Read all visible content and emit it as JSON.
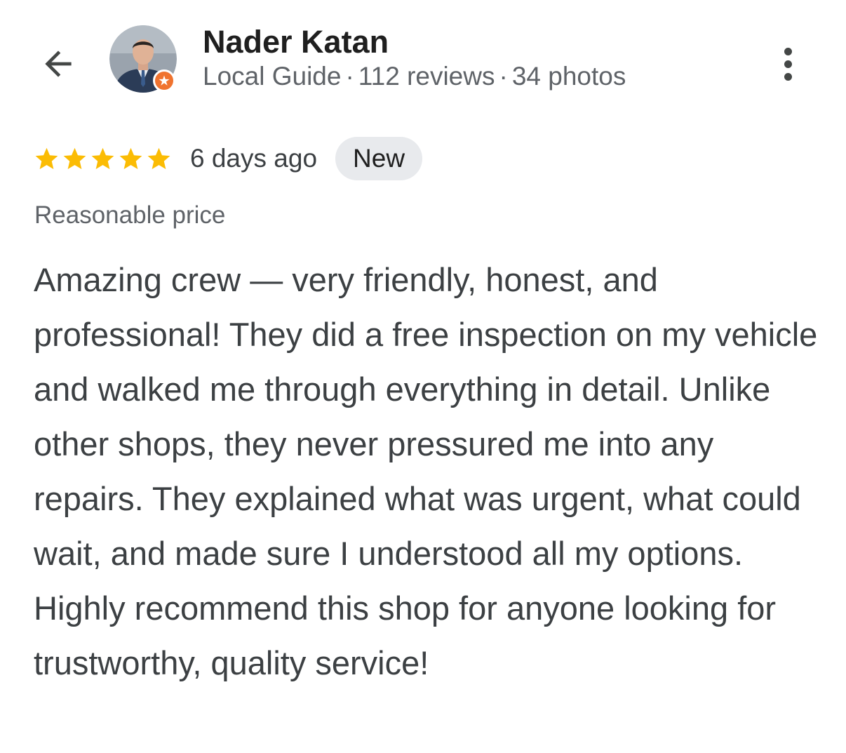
{
  "header": {
    "back_icon": "arrow-left-icon",
    "more_icon": "more-vert-icon",
    "colors": {
      "badge": "#f0732f",
      "star": "#fbbc04"
    }
  },
  "reviewer": {
    "name": "Nader Katan",
    "level": "Local Guide",
    "separator": "·",
    "reviews": "112 reviews",
    "photos": "34 photos"
  },
  "review": {
    "rating": 5,
    "rating_max": 5,
    "date": "6 days ago",
    "badge": "New",
    "attribute": "Reasonable price",
    "text": "Amazing crew — very friendly, honest, and professional! They did a free inspection on my vehicle and walked me through everything in detail. Unlike other shops, they never pressured me into any repairs. They explained what was urgent, what could wait, and made sure I understood all my options. Highly recommend this shop for anyone looking for trustworthy, quality service!"
  }
}
